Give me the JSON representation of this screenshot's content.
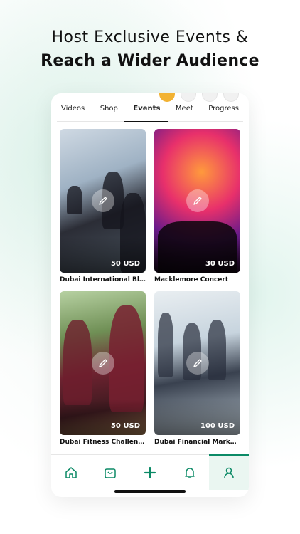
{
  "headline": {
    "line1": "Host Exclusive Events &",
    "line2": "Reach a Wider Audience"
  },
  "tabs": [
    {
      "label": "Videos",
      "active": false
    },
    {
      "label": "Shop",
      "active": false
    },
    {
      "label": "Events",
      "active": true
    },
    {
      "label": "Meet",
      "active": false
    },
    {
      "label": "Progress",
      "active": false
    }
  ],
  "events": [
    {
      "title": "Dubai International Bloc...",
      "price": "50 USD"
    },
    {
      "title": "Macklemore Concert",
      "price": "30 USD"
    },
    {
      "title": "Dubai Fitness Challenge",
      "price": "50 USD"
    },
    {
      "title": "Dubai Financial Market (...",
      "price": "100 USD"
    }
  ],
  "nav": [
    {
      "icon": "home-icon",
      "active": false
    },
    {
      "icon": "bag-icon",
      "active": false
    },
    {
      "icon": "plus-icon",
      "active": false
    },
    {
      "icon": "bell-icon",
      "active": false
    },
    {
      "icon": "user-icon",
      "active": true
    }
  ],
  "colors": {
    "accent": "#0b8a66",
    "gold": "#f2b233"
  }
}
